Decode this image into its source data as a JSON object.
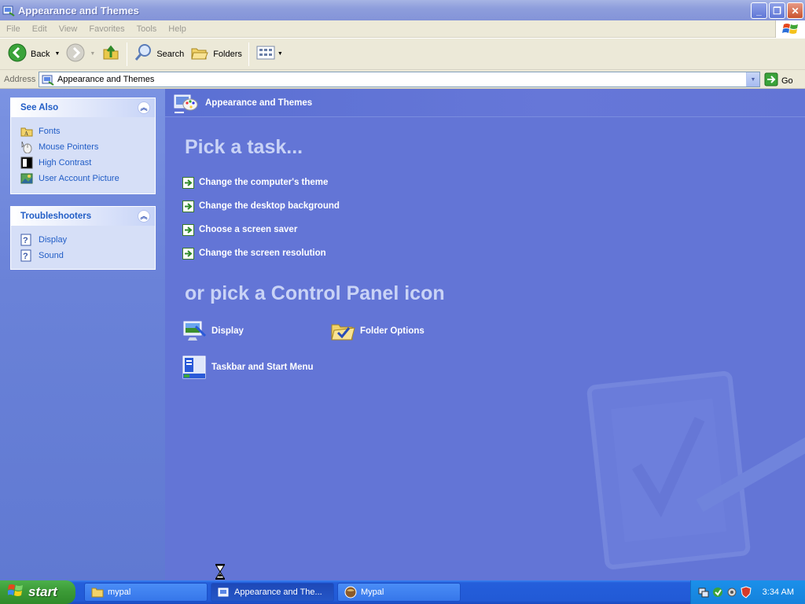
{
  "window": {
    "title": "Appearance and Themes"
  },
  "menu": [
    "File",
    "Edit",
    "View",
    "Favorites",
    "Tools",
    "Help"
  ],
  "toolbar": {
    "back_label": "Back",
    "search_label": "Search",
    "folders_label": "Folders"
  },
  "address": {
    "label": "Address",
    "value": "Appearance and Themes",
    "go_label": "Go"
  },
  "sidebar": {
    "see_also": {
      "title": "See Also",
      "items": [
        {
          "label": "Fonts",
          "icon": "fonts-folder-icon"
        },
        {
          "label": "Mouse Pointers",
          "icon": "mouse-icon"
        },
        {
          "label": "High Contrast",
          "icon": "high-contrast-icon"
        },
        {
          "label": "User Account Picture",
          "icon": "user-picture-icon"
        }
      ]
    },
    "troubleshooters": {
      "title": "Troubleshooters",
      "items": [
        {
          "label": "Display",
          "icon": "help-icon"
        },
        {
          "label": "Sound",
          "icon": "help-icon"
        }
      ]
    }
  },
  "content": {
    "header_title": "Appearance and Themes",
    "pick_task_heading": "Pick a task...",
    "tasks": [
      "Change the computer's theme",
      "Change the desktop background",
      "Choose a screen saver",
      "Change the screen resolution"
    ],
    "pick_icon_heading": "or pick a Control Panel icon",
    "icons": [
      {
        "label": "Display",
        "icon": "display-icon"
      },
      {
        "label": "Folder Options",
        "icon": "folder-options-icon"
      },
      {
        "label": "Taskbar and Start Menu",
        "icon": "taskbar-icon"
      }
    ]
  },
  "taskbar": {
    "start_label": "start",
    "buttons": [
      {
        "label": "mypal",
        "icon": "folder-icon"
      },
      {
        "label": "Appearance and The...",
        "icon": "control-panel-icon",
        "active": true
      },
      {
        "label": "Mypal",
        "icon": "browser-icon"
      }
    ],
    "clock": "3:34 AM"
  },
  "colors": {
    "content_bg": "#6375d6",
    "sidebar_link": "#215dc6",
    "heading": "#c9d3f6"
  }
}
